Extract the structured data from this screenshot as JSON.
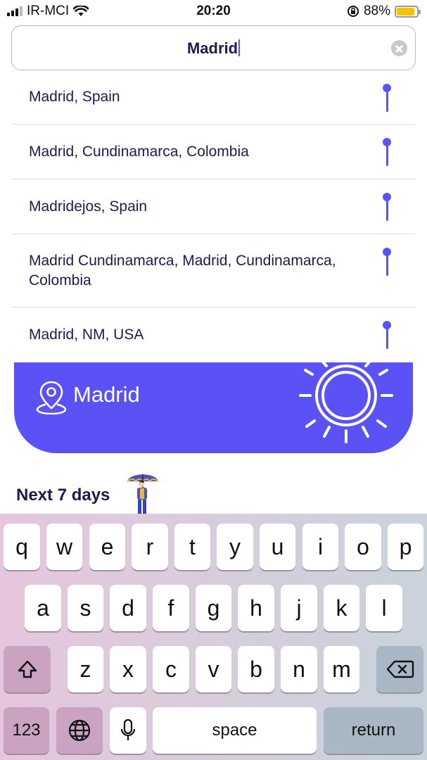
{
  "status_bar": {
    "carrier": "IR-MCI",
    "time": "20:20",
    "battery_percent": "88%",
    "battery_level": 0.88,
    "icons": [
      "signal-icon",
      "wifi-icon",
      "rotation-lock-icon",
      "battery-icon"
    ]
  },
  "search": {
    "value": "Madrid",
    "clear_icon": "clear-icon"
  },
  "suggestions": [
    {
      "label": "Madrid, Spain",
      "icon": "location-pin-icon"
    },
    {
      "label": "Madrid, Cundinamarca, Colombia",
      "icon": "location-pin-icon"
    },
    {
      "label": "Madridejos, Spain",
      "icon": "location-pin-icon"
    },
    {
      "label": "Madrid Cundinamarca, Madrid, Cundinamarca, Colombia",
      "icon": "location-pin-icon"
    },
    {
      "label": "Madrid, NM, USA",
      "icon": "location-pin-icon"
    }
  ],
  "weather_card": {
    "city": "Madrid",
    "location_icon": "location-icon",
    "weather_icon": "sun-icon",
    "background_color": "#5a52f5"
  },
  "forecast": {
    "heading": "Next 7 days",
    "illustration": "person-with-umbrella-icon"
  },
  "keyboard": {
    "row1": [
      "q",
      "w",
      "e",
      "r",
      "t",
      "y",
      "u",
      "i",
      "o",
      "p"
    ],
    "row2": [
      "a",
      "s",
      "d",
      "f",
      "g",
      "h",
      "j",
      "k",
      "l"
    ],
    "row3": [
      "z",
      "x",
      "c",
      "v",
      "b",
      "n",
      "m"
    ],
    "shift_icon": "shift-icon",
    "backspace_icon": "backspace-icon",
    "numbers_label": "123",
    "globe_icon": "globe-icon",
    "mic_icon": "microphone-icon",
    "space_label": "space",
    "return_label": "return"
  },
  "colors": {
    "accent": "#5a52f5",
    "text_dark": "#1c1b4d"
  }
}
